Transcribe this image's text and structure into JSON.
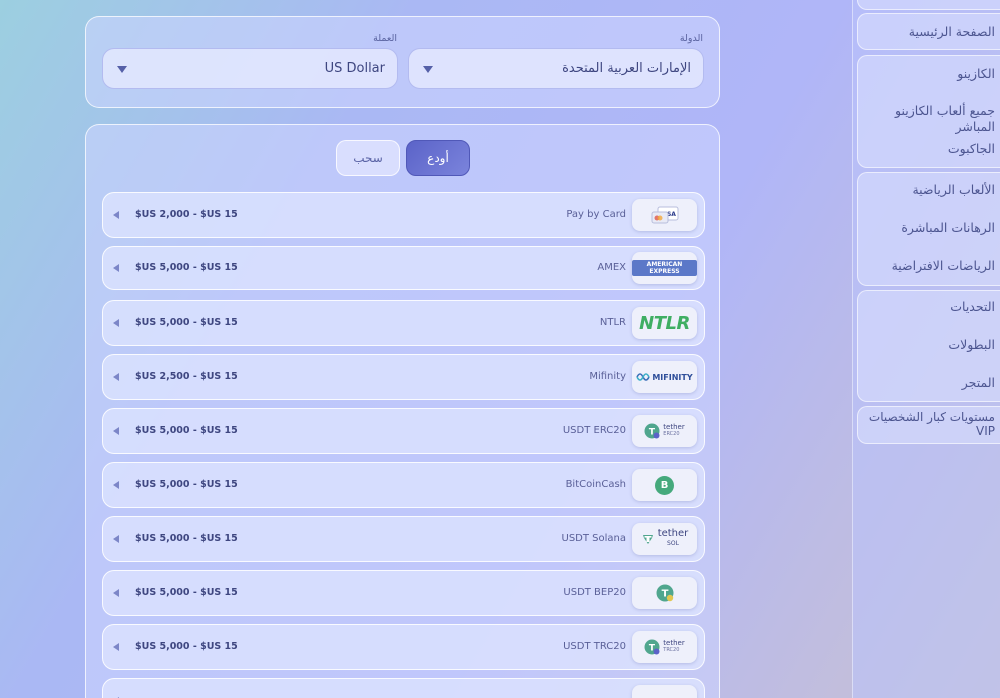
{
  "sidebar": {
    "items": [
      {
        "label": "الصفحة الرئيسية"
      },
      {
        "label": "الكازينو"
      },
      {
        "label": "جميع ألعاب الكازينو المباشر"
      },
      {
        "label": "الجاكبوت"
      },
      {
        "label": "الألعاب الرياضية"
      },
      {
        "label": "الرهانات المباشرة"
      },
      {
        "label": "الرياضات الافتراضية"
      },
      {
        "label": "التحديات"
      },
      {
        "label": "البطولات"
      },
      {
        "label": "المتجر"
      },
      {
        "label": "مستويات كبار الشخصيات VIP"
      }
    ]
  },
  "filters": {
    "country_label": "الدولة",
    "country_value": "الإمارات العربية المتحدة",
    "currency_label": "العملة",
    "currency_value": "US Dollar"
  },
  "tabs": {
    "deposit": "أودع",
    "withdraw": "سحب"
  },
  "methods": [
    {
      "name": "Pay by Card",
      "range": "$US 2,000 - $US 15",
      "logo": "visa-card-icon"
    },
    {
      "name": "AMEX",
      "range": "$US 5,000 - $US 15",
      "logo": "amex-icon",
      "logo_text": "AMERICAN EXPRESS"
    },
    {
      "name": "NTLR",
      "range": "$US 5,000 - $US 15",
      "logo": "ntlr-icon",
      "logo_text": "NTLR"
    },
    {
      "name": "Mifinity",
      "range": "$US 2,500 - $US 15",
      "logo": "mifinity-icon",
      "logo_text": "MIFINITY"
    },
    {
      "name": "USDT ERC20",
      "range": "$US 5,000 - $US 15",
      "logo": "tether-erc20-icon",
      "logo_text": "tether",
      "logo_sub": "ERC20"
    },
    {
      "name": "BitCoinCash",
      "range": "$US 5,000 - $US 15",
      "logo": "bitcoincash-icon",
      "logo_text": "B"
    },
    {
      "name": "USDT Solana",
      "range": "$US 5,000 - $US 15",
      "logo": "tether-sol-icon",
      "logo_text": "tether",
      "logo_sub": "SOL"
    },
    {
      "name": "USDT BEP20",
      "range": "$US 5,000 - $US 15",
      "logo": "tether-bep20-icon",
      "logo_text": "T"
    },
    {
      "name": "USDT TRC20",
      "range": "$US 5,000 - $US 15",
      "logo": "tether-trc20-icon",
      "logo_text": "tether",
      "logo_sub": "TRC20"
    }
  ],
  "colors": {
    "accent": "#5b63c8",
    "ntlr_green": "#3fae63",
    "tether_green": "#50a68e"
  }
}
